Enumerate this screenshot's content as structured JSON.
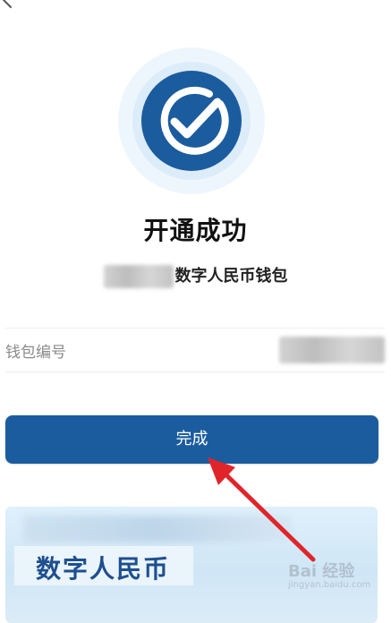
{
  "header": {
    "back_icon": "chevron-left-icon"
  },
  "status": {
    "badge_icon": "check-circle-icon",
    "title": "开通成功",
    "wallet_name_suffix": "数字人民币钱包"
  },
  "wallet": {
    "label": "钱包编号"
  },
  "actions": {
    "done_label": "完成"
  },
  "promo": {
    "title": "数字人民币"
  },
  "watermark": {
    "main": "Bai 经验",
    "sub": "jingyan.baidu.com"
  },
  "colors": {
    "brand_blue": "#1b5c9e",
    "annotation_red": "#e0252a"
  }
}
